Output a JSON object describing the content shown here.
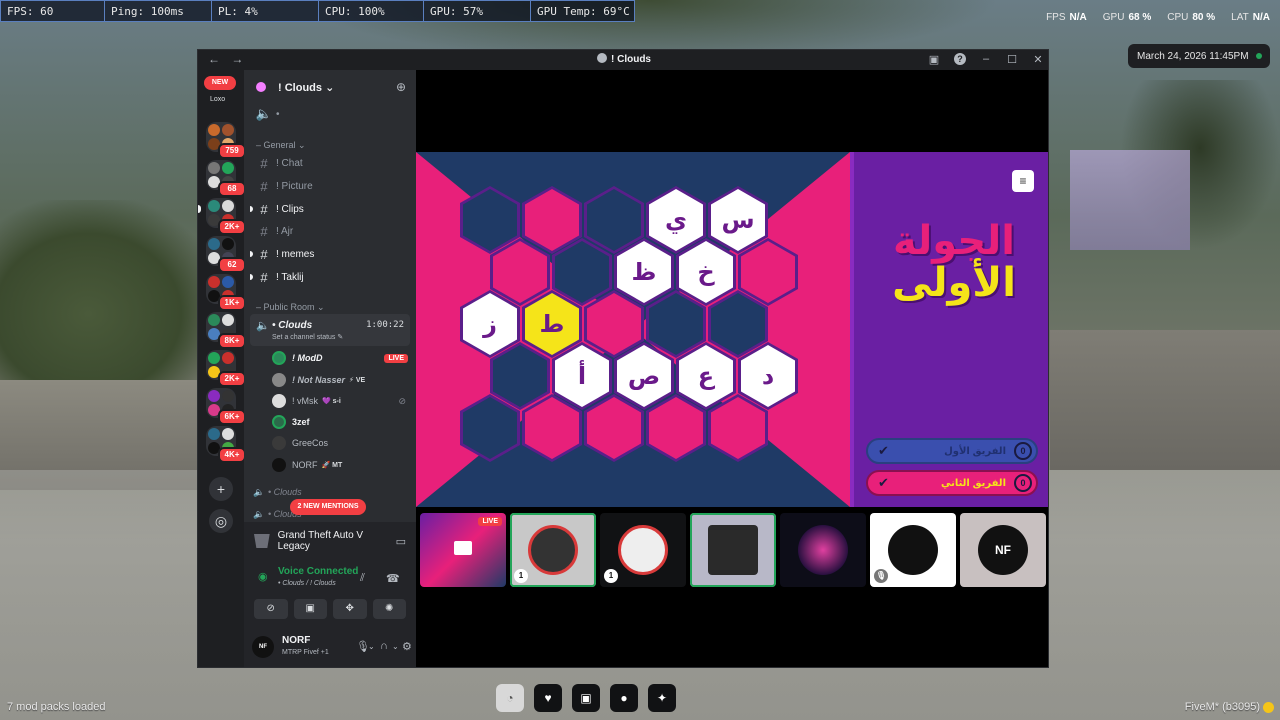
{
  "perf": [
    "FPS: 60",
    "Ping: 100ms",
    "PL: 4%",
    "CPU: 100%",
    "GPU: 57%",
    "GPU Temp: 69°C"
  ],
  "overlay": {
    "fps_label": "FPS",
    "fps_val": "N/A",
    "gpu_label": "GPU",
    "gpu_val": "68 %",
    "cpu_label": "CPU",
    "cpu_val": "80 %",
    "lat_label": "LAT",
    "lat_val": "N/A"
  },
  "datetime": "March 24, 2026 11:45PM",
  "window": {
    "title": "! Clouds",
    "nav_back": "←",
    "nav_fwd": "→",
    "help": "?",
    "minimize": "–",
    "maximize": "☐",
    "close": "✕"
  },
  "rail": {
    "new_label": "NEW",
    "home_label": "Loxo",
    "badges": [
      "759",
      "68",
      "2K+",
      "62",
      "1K+",
      "8K+",
      "2K+",
      "6K+",
      "4K+"
    ],
    "add_server": "+",
    "discover": "◎"
  },
  "guild": {
    "name": "! Clouds",
    "chevron": "⌄"
  },
  "channels": {
    "top_voice": "•",
    "category_general": "General",
    "text": [
      "! Chat",
      "! Picture",
      "! Clips",
      "! Ajr",
      "! memes",
      "! Taklij"
    ],
    "category_public": "Public Room"
  },
  "active_voice": {
    "name": "• Clouds",
    "timer": "1:00:22",
    "status": "Set a channel status ✎"
  },
  "members": [
    {
      "name": "! ModD",
      "extra": "LIVE"
    },
    {
      "name": "! Not Nasser",
      "extra": "⚡ VE"
    },
    {
      "name": "! vMsk",
      "extra": "💜 s-i"
    },
    {
      "name": "3zef",
      "extra": ""
    },
    {
      "name": "GreeCos",
      "extra": ""
    },
    {
      "name": "NORF",
      "extra": "🚀 MT"
    }
  ],
  "extra_voice": [
    "• Clouds",
    "• Clouds"
  ],
  "mentions_label": "2 NEW MENTIONS",
  "activity": {
    "game": "Grand Theft Auto V Legacy",
    "voice_status": "Voice Connected",
    "voice_sub": "• Clouds / ! Clouds"
  },
  "user": {
    "avatar_text": "NF",
    "name": "NORF",
    "status": "MTRP Fivef +1"
  },
  "board": {
    "rows": [
      [
        {
          "c": "navy",
          "l": ""
        },
        {
          "c": "pink",
          "l": ""
        },
        {
          "c": "navy",
          "l": ""
        },
        {
          "c": "white",
          "l": "ي"
        },
        {
          "c": "white",
          "l": "س"
        }
      ],
      [
        {
          "c": "pink",
          "l": ""
        },
        {
          "c": "navy",
          "l": ""
        },
        {
          "c": "white",
          "l": "ظ"
        },
        {
          "c": "white",
          "l": "خ"
        },
        {
          "c": "pink",
          "l": ""
        }
      ],
      [
        {
          "c": "white",
          "l": "ز"
        },
        {
          "c": "yellow",
          "l": "ط"
        },
        {
          "c": "pink",
          "l": ""
        },
        {
          "c": "navy",
          "l": ""
        },
        {
          "c": "navy",
          "l": ""
        }
      ],
      [
        {
          "c": "navy",
          "l": ""
        },
        {
          "c": "white",
          "l": "أ"
        },
        {
          "c": "white",
          "l": "ص"
        },
        {
          "c": "white",
          "l": "ع"
        },
        {
          "c": "white",
          "l": "د"
        }
      ],
      [
        {
          "c": "navy",
          "l": ""
        },
        {
          "c": "pink",
          "l": ""
        },
        {
          "c": "pink",
          "l": ""
        },
        {
          "c": "pink",
          "l": ""
        },
        {
          "c": "pink",
          "l": ""
        }
      ]
    ]
  },
  "round": {
    "line1": "الجولة",
    "line2": "الأولى"
  },
  "teams": [
    {
      "name": "الفريق الأول",
      "score": "0"
    },
    {
      "name": "الفريق الثاني",
      "score": "0"
    }
  ],
  "menu_icon": "≡",
  "tiles": [
    {
      "live": "LIVE",
      "corner": ""
    },
    {
      "live": "",
      "corner": "1"
    },
    {
      "live": "",
      "corner": "1"
    },
    {
      "live": "",
      "corner": ""
    },
    {
      "live": "",
      "corner": ""
    },
    {
      "live": "",
      "corner": "🎙"
    },
    {
      "live": "",
      "corner": ""
    }
  ],
  "tile_nf_text": "NF",
  "taskbar": [
    "◔",
    "♥",
    "▣",
    "●",
    "✦"
  ],
  "mods_text": "7 mod packs loaded",
  "fivem_text": "FiveM* (b3095)",
  "colors": {
    "accent_pink": "#e8207a",
    "navy": "#1f3a66",
    "yellow": "#f5e419",
    "purple": "#6a1fa3",
    "discord_green": "#23a559",
    "discord_red": "#f23f43"
  }
}
